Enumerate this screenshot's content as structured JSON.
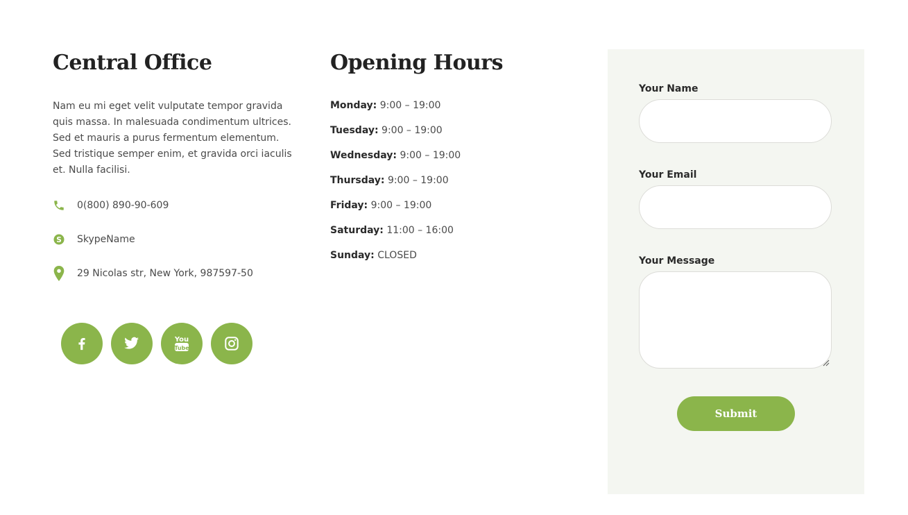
{
  "office": {
    "title": "Central Office",
    "description": "Nam eu mi eget velit vulputate tempor gravida quis massa. In malesuada condimentum ultrices. Sed et mauris a purus fermentum elementum. Sed tristique semper enim, et gravida orci iaculis et. Nulla facilisi.",
    "phone": "0(800) 890-90-609",
    "skype": "SkypeName",
    "address": "29 Nicolas str, New York, 987597-50"
  },
  "social": [
    {
      "name": "facebook-icon"
    },
    {
      "name": "twitter-icon"
    },
    {
      "name": "youtube-icon",
      "text_you": "You",
      "text_tube": "Tube"
    },
    {
      "name": "instagram-icon"
    }
  ],
  "hours": {
    "title": "Opening Hours",
    "days": [
      {
        "day": "Monday:",
        "time": "9:00 – 19:00"
      },
      {
        "day": "Tuesday:",
        "time": "9:00 – 19:00"
      },
      {
        "day": "Wednesday:",
        "time": "9:00 – 19:00"
      },
      {
        "day": "Thursday:",
        "time": "9:00 – 19:00"
      },
      {
        "day": "Friday:",
        "time": "9:00 – 19:00"
      },
      {
        "day": "Saturday:",
        "time": "11:00 – 16:00"
      },
      {
        "day": "Sunday:",
        "time": "CLOSED"
      }
    ]
  },
  "form": {
    "name_label": "Your Name",
    "name_value": "",
    "email_label": "Your Email",
    "email_value": "",
    "message_label": "Your Message",
    "message_value": "",
    "submit_label": "Submit"
  },
  "colors": {
    "accent": "#8bb54b",
    "form_background": "#f4f6f1",
    "heading": "#222222"
  }
}
